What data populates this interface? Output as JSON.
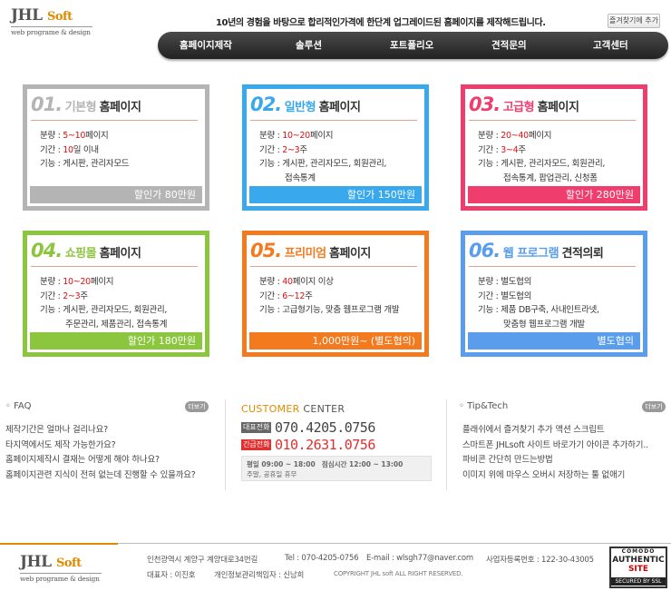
{
  "header": {
    "logo_main": "JHL",
    "logo_soft": "Soft",
    "logo_sub": "web programe & design",
    "slogan": "10년의 경험을 바탕으로 합리적인가격에 한단계 업그레이드된 홈페이지를 제작해드립니다.",
    "fav_button": "즐겨찾기에 추가"
  },
  "nav": [
    "홈페이지제작",
    "솔루션",
    "포트폴리오",
    "견적문의",
    "고객센터"
  ],
  "colors": {
    "gray": "#b4b4b4",
    "blue": "#3aa8ec",
    "pink": "#ef3d6d",
    "green": "#8cc63f",
    "orange": "#f47a20",
    "lightblue": "#5a9ded"
  },
  "plans": [
    {
      "num": "01.",
      "type": "기본형",
      "label": "홈페이지",
      "rows": [
        {
          "k": "분량 :",
          "pre": "",
          "hl": "5~10",
          "post": "페이지",
          "cont": ""
        },
        {
          "k": "기간 :",
          "pre": "",
          "hl": "10",
          "post": "일 이내",
          "cont": ""
        },
        {
          "k": "기능 :",
          "pre": "게시판, 관리자모드",
          "hl": "",
          "post": "",
          "cont": ""
        }
      ],
      "price": "할인가 80만원"
    },
    {
      "num": "02.",
      "type": "일반형",
      "label": "홈페이지",
      "rows": [
        {
          "k": "분량 :",
          "pre": "",
          "hl": "10~20",
          "post": "페이지",
          "cont": ""
        },
        {
          "k": "기간 :",
          "pre": "",
          "hl": "2~3",
          "post": "주",
          "cont": ""
        },
        {
          "k": "기능 :",
          "pre": "게시판, 관리자모드, 회원관리,",
          "hl": "",
          "post": "",
          "cont": "접속통계"
        }
      ],
      "price": "할인가 150만원"
    },
    {
      "num": "03.",
      "type": "고급형",
      "label": "홈페이지",
      "rows": [
        {
          "k": "분량 :",
          "pre": "",
          "hl": "20~40",
          "post": "페이지",
          "cont": ""
        },
        {
          "k": "기간 :",
          "pre": "",
          "hl": "3~4",
          "post": "주",
          "cont": ""
        },
        {
          "k": "기능 :",
          "pre": "게시판, 관리자모드, 회원관리,",
          "hl": "",
          "post": "",
          "cont": "접속통계, 팝업관리, 신청폼"
        }
      ],
      "price": "할인가 280만원"
    },
    {
      "num": "04.",
      "type": "쇼핑몰",
      "label": "홈페이지",
      "rows": [
        {
          "k": "분량 :",
          "pre": "",
          "hl": "10~20",
          "post": "페이지",
          "cont": ""
        },
        {
          "k": "기간 :",
          "pre": "",
          "hl": "2~3",
          "post": "주",
          "cont": ""
        },
        {
          "k": "기능 :",
          "pre": "게시판, 관리자모드, 회원관리,",
          "hl": "",
          "post": "",
          "cont": "주문관리, 제품관리, 접속통계"
        }
      ],
      "price": "할인가 180만원"
    },
    {
      "num": "05.",
      "type": "프리미엄",
      "label": "홈페이지",
      "rows": [
        {
          "k": "분량 :",
          "pre": "",
          "hl": "40",
          "post": "페이지 이상",
          "cont": ""
        },
        {
          "k": "기간 :",
          "pre": "",
          "hl": "6~12",
          "post": "주",
          "cont": ""
        },
        {
          "k": "기능 :",
          "pre": "고급형기능, 맞춤 웹프로그램 개발",
          "hl": "",
          "post": "",
          "cont": ""
        }
      ],
      "price": "1,000만원~ (별도협의)"
    },
    {
      "num": "06.",
      "type": "웹 프로그램",
      "label": "견적의뢰",
      "rows": [
        {
          "k": "분량 :",
          "pre": "별도협의",
          "hl": "",
          "post": "",
          "cont": ""
        },
        {
          "k": "기간 :",
          "pre": "별도협의",
          "hl": "",
          "post": "",
          "cont": ""
        },
        {
          "k": "기능 :",
          "pre": "제품 DB구축, 사내인트라넷,",
          "hl": "",
          "post": "",
          "cont": "맞춤형 웹프로그램 개발"
        }
      ],
      "price": "별도협의"
    }
  ],
  "faq": {
    "title": "FAQ",
    "more": "더보기",
    "items": [
      "제작기간은 얼마나 걸리나요?",
      "타지역에서도 제작 가능한가요?",
      "홈페이지제작시 결재는 어떻게 해야 하나요?",
      "홈페이지관련 지식이 전혀 없는데 진행할 수 있을까요?"
    ]
  },
  "customer": {
    "title_accent": "CUSTOMER",
    "title_rest": " CENTER",
    "rep_tag": "대표전화",
    "rep_phone": "070.4205.0756",
    "urgent_tag": "긴급전화",
    "urgent_phone": "010.2631.0756",
    "hours_line1_a": "평일 09:00 ~ 18:00",
    "hours_line1_b": "점심시간 12:00 ~ 13:00",
    "hours_line2": "주말, 공휴일 휴무"
  },
  "tip": {
    "title": "Tip&Tech",
    "more": "더보기",
    "items": [
      "플래쉬에서 즐겨찾기 추가 액션 스크립트",
      "스마트폰 JHLsoft 사이트 바로가기 아이콘 추가하기..",
      "파비콘 간단히 만드는방법",
      "이미지 위에 마우스 오버시 저장하는 툴 없애기"
    ]
  },
  "footer": {
    "address": "인천광역시 계양구 계양대로34번길",
    "tel": "Tel : 070-4205-0756",
    "email": "E-mail : wlsgh77@naver.com",
    "bizno": "사업자등록번호 : 122-30-43005",
    "ceo": "대표자 : 이진호",
    "privacy": "개인정보관리책임자 : 신남희",
    "copyright": "COPYRIGHT   JHL soft   ALL RIGHT RESERVED.",
    "ssl_l1": "COMODO",
    "ssl_l2": "AUTHENTIC",
    "ssl_l3": "SITE",
    "ssl_l4": "SECURED BY SSL"
  }
}
